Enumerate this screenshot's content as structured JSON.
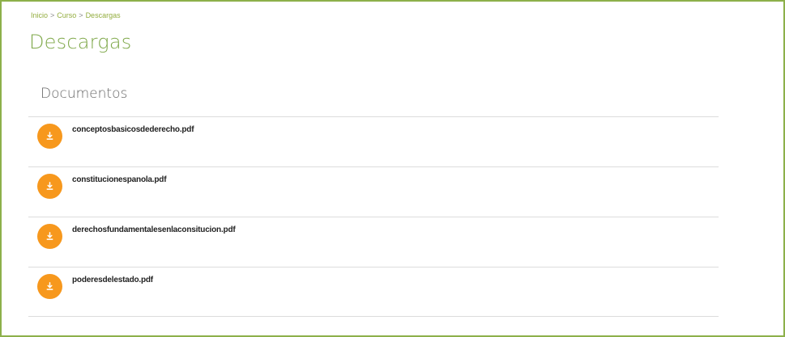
{
  "breadcrumb": {
    "items": [
      "Inicio",
      "Curso",
      "Descargas"
    ],
    "separator": ">"
  },
  "page": {
    "title": "Descargas"
  },
  "section": {
    "title": "Documentos"
  },
  "files": [
    {
      "name": "conceptosbasicosdederecho.pdf",
      "icon": "download-icon"
    },
    {
      "name": "constitucionespanola.pdf",
      "icon": "download-icon"
    },
    {
      "name": "derechosfundamentalesenlaconsitucion.pdf",
      "icon": "download-icon"
    },
    {
      "name": "poderesdelestado.pdf",
      "icon": "download-icon"
    }
  ],
  "colors": {
    "accent_green": "#7fa84a",
    "breadcrumb_green": "#93ad3e",
    "download_orange": "#f7981d",
    "frame_border": "#8db04a"
  }
}
